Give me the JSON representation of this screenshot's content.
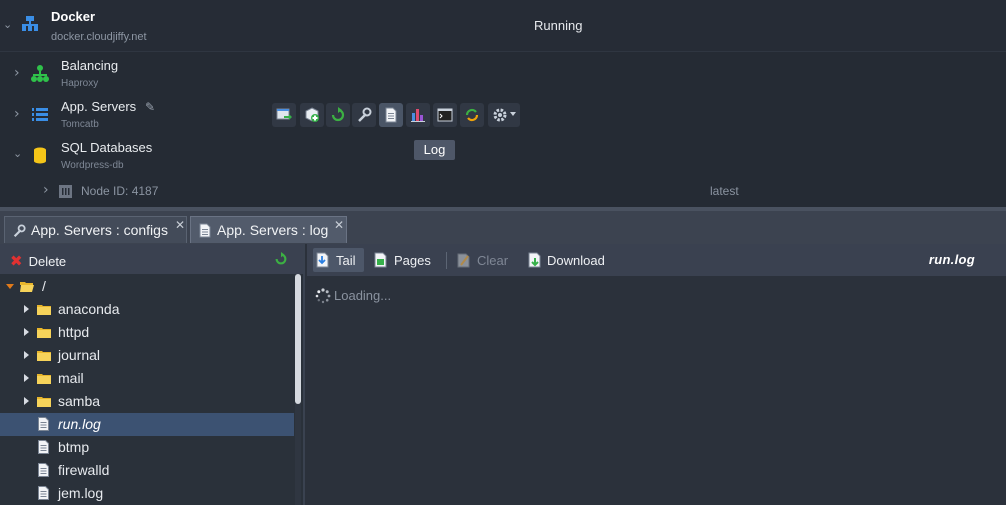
{
  "environment": {
    "name": "Docker",
    "domain": "docker.cloudjiffy.net",
    "status": "Running",
    "layers": [
      {
        "name": "Balancing",
        "stack": "Haproxy"
      },
      {
        "name": "App. Servers",
        "stack": "Tomcatb"
      },
      {
        "name": "SQL Databases",
        "stack": "Wordpress-db"
      }
    ],
    "node": {
      "label": "Node ID: 4187",
      "tag": "latest"
    }
  },
  "toolbar_icons": [
    "redeploy-icon",
    "add-node-icon",
    "restart-icon",
    "config-icon",
    "log-icon",
    "statistics-icon",
    "terminal-icon",
    "clone-icon",
    "settings-icon"
  ],
  "tooltip": "Log",
  "tabs": [
    {
      "label": "App. Servers : configs",
      "icon": "wrench-icon"
    },
    {
      "label": "App. Servers : log",
      "icon": "document-icon"
    }
  ],
  "files": {
    "delete_label": "Delete",
    "root": "/",
    "items": [
      {
        "name": "anaconda",
        "type": "folder"
      },
      {
        "name": "httpd",
        "type": "folder"
      },
      {
        "name": "journal",
        "type": "folder"
      },
      {
        "name": "mail",
        "type": "folder"
      },
      {
        "name": "samba",
        "type": "folder"
      },
      {
        "name": "run.log",
        "type": "file",
        "selected": true
      },
      {
        "name": "btmp",
        "type": "file"
      },
      {
        "name": "firewalld",
        "type": "file"
      },
      {
        "name": "jem.log",
        "type": "file"
      }
    ]
  },
  "log": {
    "tail": "Tail",
    "pages": "Pages",
    "clear": "Clear",
    "download": "Download",
    "file": "run.log",
    "loading": "Loading..."
  },
  "colors": {
    "accent": "#3c5272",
    "folder": "#f4c842",
    "delete": "#e13131",
    "refresh": "#3cb043"
  }
}
